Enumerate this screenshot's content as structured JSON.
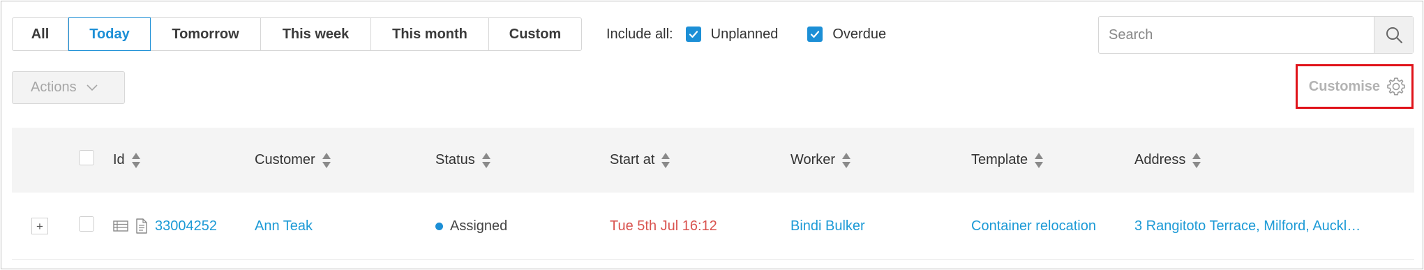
{
  "filters": {
    "tabs": [
      {
        "label": "All",
        "active": false
      },
      {
        "label": "Today",
        "active": true
      },
      {
        "label": "Tomorrow",
        "active": false
      },
      {
        "label": "This week",
        "active": false
      },
      {
        "label": "This month",
        "active": false
      },
      {
        "label": "Custom",
        "active": false
      }
    ],
    "include_label": "Include all:",
    "unplanned_label": "Unplanned",
    "unplanned_checked": true,
    "overdue_label": "Overdue",
    "overdue_checked": true
  },
  "search": {
    "placeholder": "Search",
    "icon": "search-icon"
  },
  "toolbar": {
    "actions_label": "Actions",
    "customise_label": "Customise",
    "customise_icon": "gear-icon"
  },
  "table": {
    "columns": [
      "Id",
      "Customer",
      "Status",
      "Start at",
      "Worker",
      "Template",
      "Address"
    ],
    "rows": [
      {
        "expander": "+",
        "id": "33004252",
        "customer": "Ann Teak",
        "status": "Assigned",
        "start_at": "Tue 5th Jul 16:12",
        "worker": "Bindi Bulker",
        "template": "Container relocation",
        "address": "3 Rangitoto Terrace, Milford, Auckl…"
      }
    ]
  },
  "colors": {
    "accent": "#1c8fd6",
    "link": "#1c9ad6",
    "date": "#d9534f",
    "highlight": "#e0131a"
  }
}
